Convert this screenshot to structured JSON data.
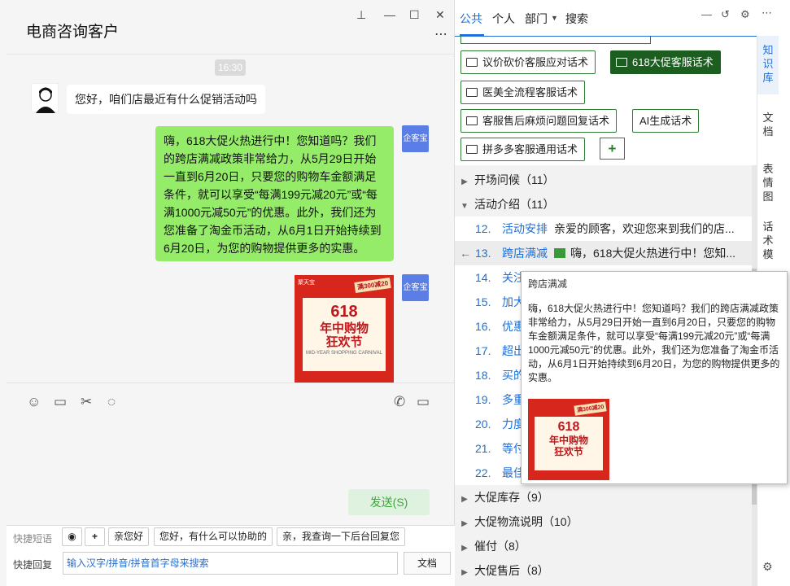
{
  "chat": {
    "title": "电商咨询客户",
    "timestamp": "16:30",
    "customer_message": "您好，咱们店最近有什么促销活动吗",
    "agent_message": "嗨，618大促火热进行中！您知道吗？我们的跨店满减政策非常给力，从5月29日开始一直到6月20日，只要您的购物车金额满足条件，就可以享受“每满199元减20元”或“每满1000元减50元”的优惠。此外，我们还为您准备了淘金币活动，从6月1日开始持续到6月20日，为您的购物提供更多的实惠。",
    "badge_label": "企客宝",
    "poster": {
      "tag": "聚天宝",
      "promo": "满300减20",
      "big": "618",
      "line1": "年中购物",
      "line2": "狂欢节",
      "sub": "MID-YEAR SHOPPING CARNIVAL"
    },
    "send_label": "发送(S)"
  },
  "quick": {
    "phrases_label": "快捷短语",
    "reply_label": "快捷回复",
    "phrases": [
      "亲您好",
      "您好，有什么可以协助的",
      "亲，我查询一下后台回复您"
    ],
    "search_placeholder": "输入汉字/拼音/拼音首字母来搜索",
    "doc_label": "文档"
  },
  "right": {
    "tabs": [
      "公共",
      "个人",
      "部门",
      "搜索"
    ],
    "side_tabs": [
      "知识库",
      "文档",
      "表情图",
      "话术模"
    ],
    "folders": [
      "议价砍价客服应对话术",
      "618大促客服话术",
      "医美全流程客服话术",
      "客服售后麻烦问题回复话术",
      "AI生成话术",
      "拼多多客服通用话术"
    ],
    "ai_label": "AI生成话术",
    "tree": [
      {
        "label": "开场问候（11）"
      },
      {
        "label": "活动介绍（11）"
      },
      {
        "num": "12.",
        "title": "活动安排",
        "text": "亲爱的顾客，欢迎您来到我们的店..."
      },
      {
        "num": "13.",
        "title": "跨店满减",
        "text": "嗨，618大促火热进行中！您知..."
      },
      {
        "num": "14.",
        "title": "关注"
      },
      {
        "num": "15.",
        "title": "加大"
      },
      {
        "num": "16.",
        "title": "优惠"
      },
      {
        "num": "17.",
        "title": "超出"
      },
      {
        "num": "18.",
        "title": "买的"
      },
      {
        "num": "19.",
        "title": "多重"
      },
      {
        "num": "20.",
        "title": "力度"
      },
      {
        "num": "21.",
        "title": "等付"
      },
      {
        "num": "22.",
        "title": "最佳"
      },
      {
        "label": "大促库存（9）"
      },
      {
        "label": "大促物流说明（10）"
      },
      {
        "label": "催付（8）"
      },
      {
        "label": "大促售后（8）"
      }
    ],
    "tooltip": {
      "title": "跨店满减",
      "body": "嗨，618大促火热进行中！您知道吗？我们的跨店满减政策非常给力，从5月29日开始一直到6月20日，只要您的购物车金额满足条件，就可以享受“每满199元减20元”或“每满1000元减50元”的优惠。此外，我们还为您准备了淘金币活动，从6月1日开始持续到6月20日，为您的购物提供更多的实惠。"
    }
  },
  "colors": {
    "accent": "#1e6fd9",
    "bubble": "#95ec69",
    "folder_active": "#1b5e20",
    "poster": "#d7261c"
  }
}
